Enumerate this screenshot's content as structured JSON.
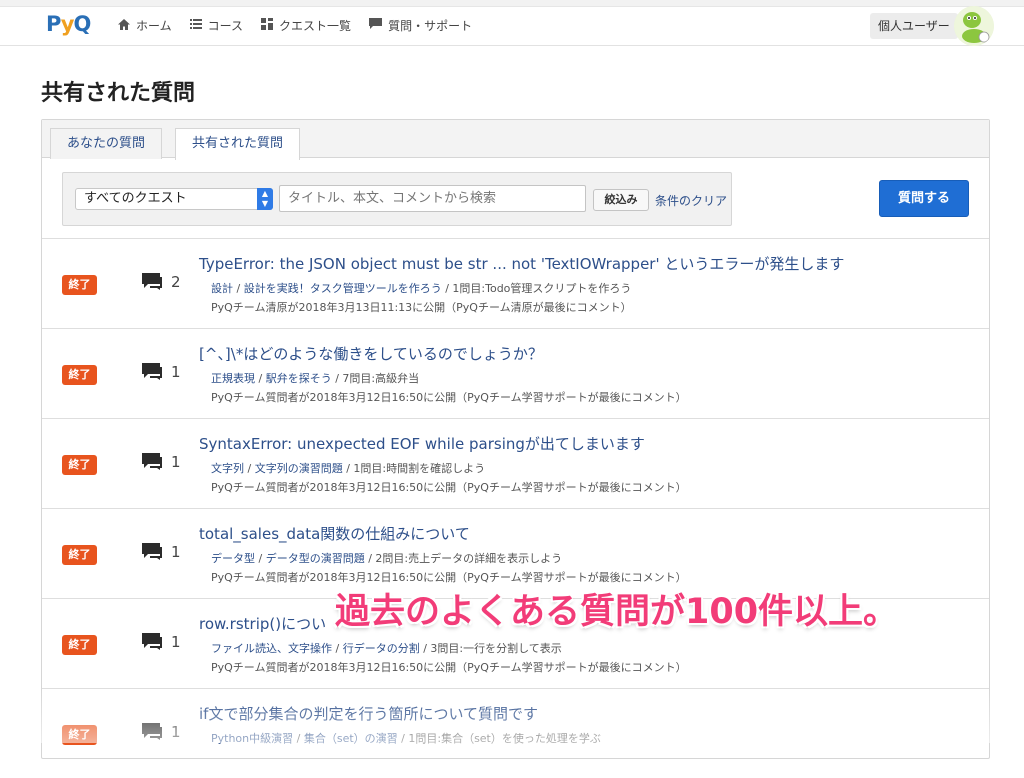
{
  "app": {
    "logo_text": "PyQ"
  },
  "nav": {
    "items": [
      {
        "label": "ホーム",
        "icon": "home-icon"
      },
      {
        "label": "コース",
        "icon": "list-icon"
      },
      {
        "label": "クエスト一覧",
        "icon": "grid-icon"
      },
      {
        "label": "質問・サポート",
        "icon": "comment-icon"
      }
    ],
    "user_label": "個人ユーザー"
  },
  "page": {
    "title": "共有された質問"
  },
  "tabs": [
    {
      "label": "あなたの質問",
      "active": false
    },
    {
      "label": "共有された質問",
      "active": true
    }
  ],
  "filter": {
    "select_value": "すべてのクエスト",
    "search_placeholder": "タイトル、本文、コメントから検索",
    "narrow_label": "絞込み",
    "clear_label": "条件のクリア",
    "ask_label": "質問する"
  },
  "questions": [
    {
      "status": "終了",
      "count": "2",
      "title": "TypeError: the JSON object must be str ... not 'TextIOWrapper' というエラーが発生します",
      "crumb1": "設計",
      "crumb2": "設計を実践！タスク管理ツールを作ろう",
      "crumb3": "1問目:Todo管理スクリプトを作ろう",
      "meta": "PyQチーム清原が2018年3月13日11:13に公開（PyQチーム清原が最後にコメント）"
    },
    {
      "status": "終了",
      "count": "1",
      "title": "[^、]\\*はどのような働きをしているのでしょうか？",
      "crumb1": "正規表現",
      "crumb2": "駅弁を探そう",
      "crumb3": "7問目:高級弁当",
      "meta": "PyQチーム質問者が2018年3月12日16:50に公開（PyQチーム学習サポートが最後にコメント）"
    },
    {
      "status": "終了",
      "count": "1",
      "title": "SyntaxError: unexpected EOF while parsingが出てしまいます",
      "crumb1": "文字列",
      "crumb2": "文字列の演習問題",
      "crumb3": "1問目:時間割を確認しよう",
      "meta": "PyQチーム質問者が2018年3月12日16:50に公開（PyQチーム学習サポートが最後にコメント）"
    },
    {
      "status": "終了",
      "count": "1",
      "title": "total_sales_data関数の仕組みについて",
      "crumb1": "データ型",
      "crumb2": "データ型の演習問題",
      "crumb3": "2問目:売上データの詳細を表示しよう",
      "meta": "PyQチーム質問者が2018年3月12日16:50に公開（PyQチーム学習サポートが最後にコメント）"
    },
    {
      "status": "終了",
      "count": "1",
      "title": "row.rstrip()につい",
      "crumb1": "ファイル読込、文字操作",
      "crumb2": "行データの分割",
      "crumb3": "3問目:一行を分割して表示",
      "meta": "PyQチーム質問者が2018年3月12日16:50に公開（PyQチーム学習サポートが最後にコメント）"
    },
    {
      "status": "終了",
      "count": "1",
      "title": "if文で部分集合の判定を行う箇所について質問です",
      "crumb1": "Python中級演習",
      "crumb2": "集合（set）の演習",
      "crumb3": "1問目:集合（set）を使った処理を学ぶ",
      "meta": ""
    }
  ],
  "overlay_text": "過去のよくある質問が100件以上。",
  "colors": {
    "link": "#2d4f8a",
    "badge": "#e8541e",
    "primary": "#1f6ed4",
    "overlay": "#f23c78"
  }
}
